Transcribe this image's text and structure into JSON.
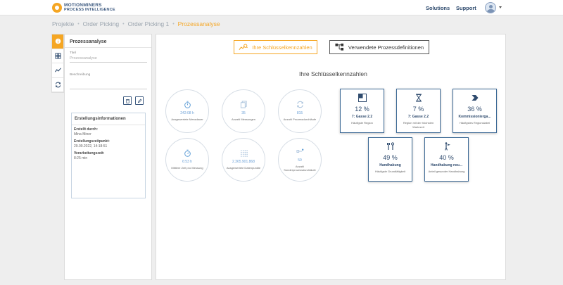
{
  "header": {
    "logo_line1": "MOTIONMINERS",
    "logo_line2": "PROCESS INTELLIGENCE",
    "nav": [
      "Solutions",
      "Support"
    ]
  },
  "breadcrumb": [
    "Projekte",
    "Order Picking",
    "Order Picking 1",
    "Prozessanalyse"
  ],
  "tabs": [
    {
      "icon": "info-circle-icon",
      "active": true
    },
    {
      "icon": "grid-icon",
      "active": false
    },
    {
      "icon": "chart-icon",
      "active": false
    },
    {
      "icon": "refresh-icon",
      "active": false
    }
  ],
  "leftpanel": {
    "title": "Prozessanalyse",
    "field_title_label": "Titel",
    "field_title_value": "Prozessanalyse",
    "field_desc_label": "Beschreibung",
    "infobox": {
      "title": "Erstellungsinformationen",
      "created_by_label": "Erstellt durch:",
      "created_by_value": "Mina Miner",
      "created_at_label": "Erstellungszeitpunkt:",
      "created_at_value": "29.09.2022, 14:18:51",
      "processing_label": "Verarbeitungszeit:",
      "processing_value": "8:25 min"
    }
  },
  "main": {
    "btn_kpis": "Ihre Schlüsselkennzahlen",
    "btn_defs": "Verwendete Prozessdefinitionen",
    "section_title": "Ihre Schlüsselkennzahlen",
    "circles": [
      {
        "icon": "stopwatch-icon",
        "value": "242:08 h",
        "label": "Ausgewertete Messdauer"
      },
      {
        "icon": "copy-icon",
        "value": "35",
        "label": "Anzahl Messungen"
      },
      {
        "icon": "process-arrows-icon",
        "value": "815",
        "label": "Anzahl Prozessdurchläufe"
      },
      {
        "icon": "stopwatch-icon",
        "value": "6:53 h",
        "label": "Mittlere Zeit pro Messung"
      },
      {
        "icon": "dots-grid-icon",
        "value": "2.365.901.868",
        "label": "Ausgewertete Datenpunkte"
      },
      {
        "icon": "special-process-icon",
        "value": "59",
        "label": "Anzahl Sonderprozessdurchläufe"
      }
    ],
    "cards": [
      {
        "icon": "region-icon",
        "pct": "12 %",
        "name": "7: Gasse 2.2",
        "sub": "Häufigste Region"
      },
      {
        "icon": "hourglass-icon",
        "pct": "7 %",
        "name": "7: Gasse 2.2",
        "sub": "Region mit der höchsten Wartezeit"
      },
      {
        "icon": "label-tag-icon",
        "pct": "36 %",
        "name": "Kommissionierga...",
        "sub": "Häufigstes Regionslabel"
      },
      {
        "icon": "handling-tools-icon",
        "pct": "49 %",
        "name": "Handhabung",
        "sub": "Häufigste Grundtätigkeit"
      },
      {
        "icon": "healthy-handling-icon",
        "pct": "40 %",
        "name": "Handhabung neu...",
        "sub": "Anteil gesunder Handhabung"
      }
    ]
  },
  "colors": {
    "accent": "#f5a623",
    "brand": "#2f4b6e",
    "kpi_value": "#6a9fd6"
  }
}
